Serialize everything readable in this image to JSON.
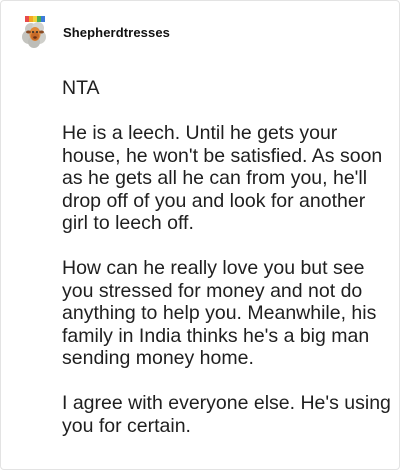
{
  "comment": {
    "username": "Shepherdtresses",
    "avatar_icon": "sheep-avatar-icon",
    "paragraphs": [
      "NTA",
      "He is a leech. Until he gets your house, he won't be satisfied. As soon as he gets all he can from you, he'll drop off of you and look for another girl to leech off.",
      "How can he really love you but see you stressed for money and not do anything to help you. Meanwhile, his family in India thinks he's a big man sending money home.",
      "I agree with everyone else. He's using you for certain."
    ]
  }
}
